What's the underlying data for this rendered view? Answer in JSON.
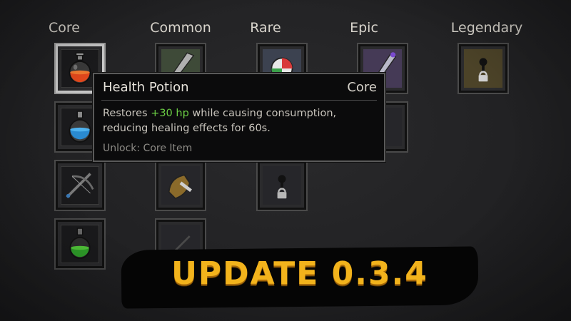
{
  "columns": [
    "Core",
    "Common",
    "Rare",
    "Epic",
    "Legendary"
  ],
  "items": {
    "core": [
      "health-potion",
      "mana-potion",
      "crossbow",
      "poison-potion"
    ],
    "common": [
      "dagger",
      "gauntlet",
      "locked-or-hidden"
    ],
    "rare": [
      "beach-ball",
      "locked"
    ],
    "epic": [
      "magic-staff",
      "hidden"
    ],
    "legendary": [
      "locked"
    ]
  },
  "tooltip": {
    "title": "Health Potion",
    "rarity": "Core",
    "desc_pre": "Restores ",
    "desc_highlight": "+30 hp",
    "desc_post": " while causing consumption, reducing healing effects for 60s.",
    "unlock": "Unlock: Core Item"
  },
  "banner": {
    "text": "UPDATE 0.3.4"
  },
  "colors": {
    "highlight_green": "#6ccf45",
    "banner_gold": "#f2b31c"
  }
}
